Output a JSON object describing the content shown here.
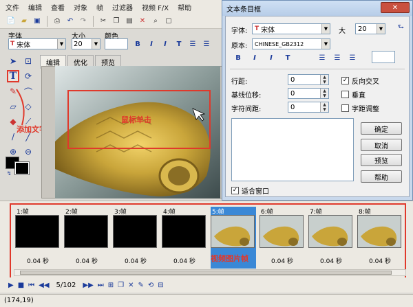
{
  "menubar": [
    "文件",
    "编辑",
    "查看",
    "对象",
    "帧",
    "过滤器",
    "视频 F/X",
    "帮助"
  ],
  "fontbar": {
    "font_label": "字体",
    "size_label": "大小",
    "color_label": "颜色",
    "font_value": "宋体",
    "size_value": "20",
    "format_buttons": [
      "B",
      "I",
      "I",
      "T"
    ]
  },
  "canvas_tabs": [
    "编辑",
    "优化",
    "预览"
  ],
  "annotations": {
    "add_text": "添加文字",
    "mouse_click": "鼠标单击",
    "video_frame": "视频图片帧"
  },
  "frames": [
    {
      "label": "1:帧",
      "duration": "0.04 秒",
      "kind": "black"
    },
    {
      "label": "2:帧",
      "duration": "0.04 秒",
      "kind": "black"
    },
    {
      "label": "3:帧",
      "duration": "0.04 秒",
      "kind": "black"
    },
    {
      "label": "4:帧",
      "duration": "0.04 秒",
      "kind": "black"
    },
    {
      "label": "5:帧",
      "duration": "",
      "kind": "fish",
      "selected": true
    },
    {
      "label": "6:帧",
      "duration": "0.04 秒",
      "kind": "fish"
    },
    {
      "label": "7:帧",
      "duration": "0.04 秒",
      "kind": "fish"
    },
    {
      "label": "8:帧",
      "duration": "0.04 秒",
      "kind": "fish"
    }
  ],
  "playbar": {
    "frame_counter": "5/102"
  },
  "status": {
    "coords": "(174,19)"
  },
  "dialog": {
    "title": "文本条目框",
    "close_label": "✕",
    "font_label": "字体:",
    "font_value": "宋体",
    "size_label": "大",
    "size_value": "20",
    "charset_label": "原本:",
    "charset_value": "CHINESE_GB2312",
    "line_spacing_label": "行距:",
    "baseline_label": "基线位移:",
    "char_spacing_label": "字符间距:",
    "line_spacing_value": "0",
    "baseline_value": "0",
    "char_spacing_value": "0",
    "reverse_aa": "反向交叉",
    "vertical": "垂直",
    "kerning": "字距调整",
    "fit_window": "适合窗口",
    "ok": "确定",
    "cancel": "取消",
    "preview": "预览",
    "help": "帮助"
  },
  "colors": {
    "annotation": "#e0392b",
    "selection": "#3a88d6",
    "fish_gold": "#c9a53a"
  }
}
